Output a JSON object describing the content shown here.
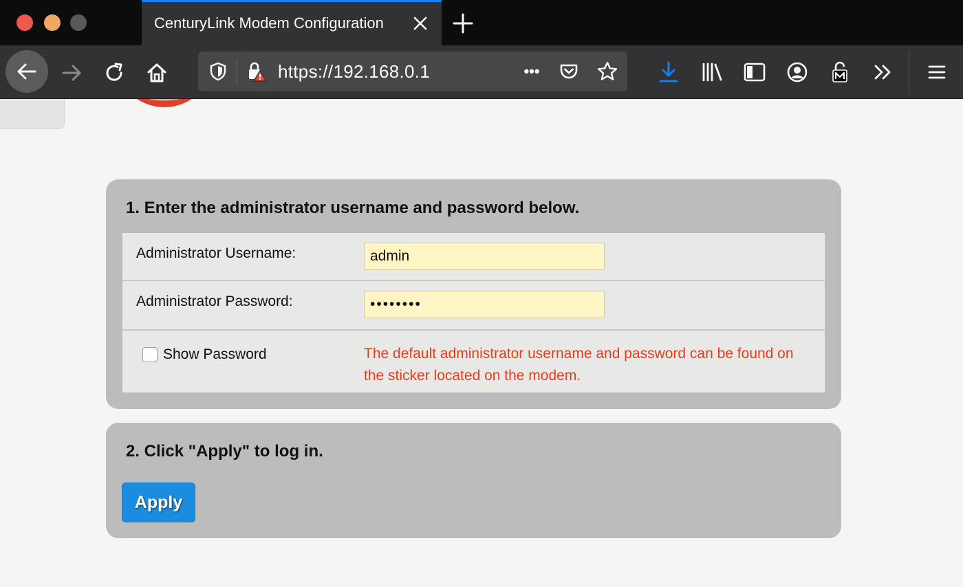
{
  "browser": {
    "tab_title": "CenturyLink Modem Configuration",
    "url": "https://192.168.0.1",
    "page_actions_label": "•••"
  },
  "colors": {
    "accent_blue": "#0a84ff",
    "apply_button": "#1b8ce0",
    "notice_text": "#e0401c",
    "panel_bg": "#bbbcbb",
    "input_bg": "#fdf5c4"
  },
  "step1": {
    "heading": "1. Enter the administrator username and password below.",
    "username_label": "Administrator Username:",
    "username_value": "admin",
    "password_label": "Administrator Password:",
    "password_value": "••••••••",
    "show_password_label": "Show Password",
    "notice": "The default administrator username and password can be found on the sticker located on the modem."
  },
  "step2": {
    "heading": "2. Click \"Apply\" to log in.",
    "apply_label": "Apply"
  }
}
